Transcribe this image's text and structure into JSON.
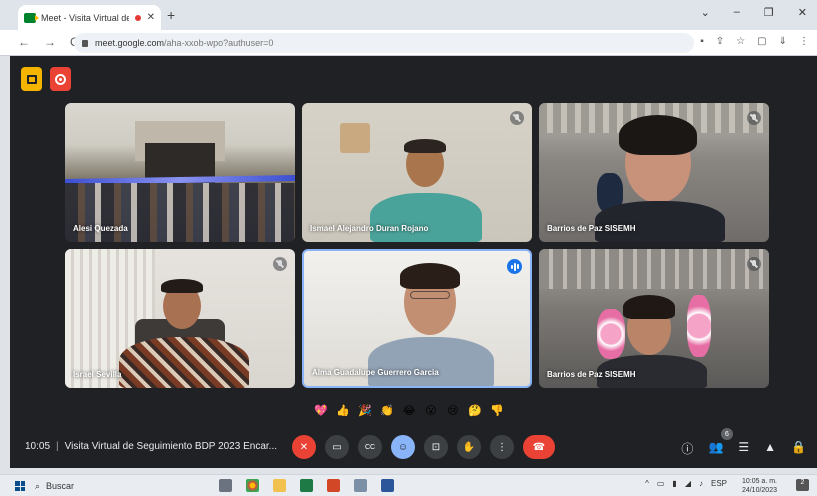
{
  "browser": {
    "tab_title": "Meet - Visita Virtual de Seg",
    "tab_close": "✕",
    "new_tab": "+",
    "window_controls": [
      "⌄",
      "–",
      "❐",
      "✕"
    ],
    "nav": [
      "←",
      "→",
      "C"
    ],
    "url_host": "meet.google.com",
    "url_path": "/aha-xxob-wpo?authuser=0",
    "address_icons": [
      "▪",
      "⇪",
      "☆",
      "▢",
      "⇓",
      "⋮"
    ]
  },
  "participants": [
    {
      "name": "Alesi Quezada",
      "muted": false
    },
    {
      "name": "Ismael Alejandro Duran Rojano",
      "muted": true
    },
    {
      "name": "Barrios de Paz SISEMH",
      "muted": true
    },
    {
      "name": "Israel Sevilla",
      "muted": true
    },
    {
      "name": "Alma Guadalupe Guerrero Garcia",
      "muted": false,
      "speaking": true
    },
    {
      "name": "Barrios de Paz SISEMH",
      "muted": true
    }
  ],
  "reactions": [
    "💖",
    "👍",
    "🎉",
    "👏",
    "😂",
    "😮",
    "😢",
    "🤔",
    "👎"
  ],
  "meeting": {
    "time": "10:05",
    "separator": "|",
    "title": "Visita Virtual de Seguimiento BDP 2023 Encar..."
  },
  "controls": {
    "mic": "✕",
    "camera": "▭",
    "captions": "CC",
    "emoji": "☺",
    "present": "⊡",
    "hand": "✋",
    "more": "⋮",
    "leave": "☎"
  },
  "right_controls": {
    "info": "ⓘ",
    "people": "👥",
    "people_count": "6",
    "chat": "☰",
    "activities": "▲",
    "host": "🔒"
  },
  "taskbar": {
    "search_placeholder": "Buscar",
    "tray_language": "ESP",
    "time": "10:05 a. m.",
    "date": "24/10/2023",
    "notifications": "2"
  }
}
